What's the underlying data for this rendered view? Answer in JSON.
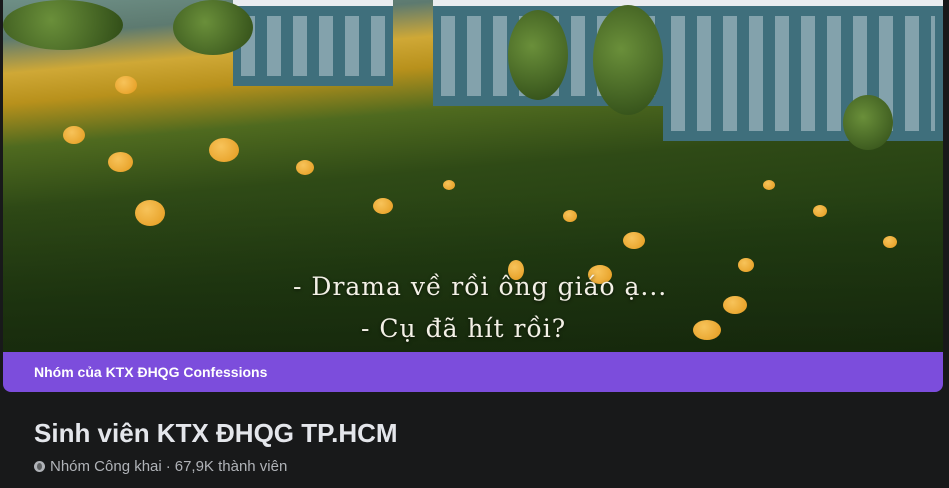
{
  "cover": {
    "caption_line1": "- Drama về rồi ông giáo ạ...",
    "caption_line2": "- Cụ đã hít rồi?"
  },
  "banner": {
    "label": "Nhóm của KTX ĐHQG Confessions",
    "color": "#7c4ddc"
  },
  "group": {
    "title": "Sinh viên KTX ĐHQG TP.HCM",
    "privacy": "Nhóm Công khai",
    "separator": "·",
    "members": "67,9K thành viên",
    "privacy_icon": "globe-icon"
  }
}
